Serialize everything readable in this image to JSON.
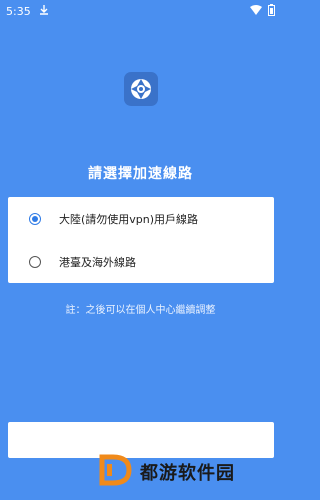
{
  "status_bar": {
    "time": "5:35",
    "download_icon": "download-icon",
    "wifi_icon": "wifi-icon",
    "battery_icon": "battery-icon"
  },
  "app": {
    "logo_icon": "app-logo-icon",
    "title": "請選擇加速線路"
  },
  "routes": [
    {
      "label": "大陸(請勿使用vpn)用戶線路",
      "selected": true
    },
    {
      "label": "港臺及海外線路",
      "selected": false
    }
  ],
  "note": "註：之後可以在個人中心繼續調整",
  "watermark": {
    "text": "都游软件园",
    "icon": "d-logo-icon"
  },
  "colors": {
    "background": "#4a8ff0",
    "accent": "#2f7be6",
    "card": "#ffffff"
  }
}
